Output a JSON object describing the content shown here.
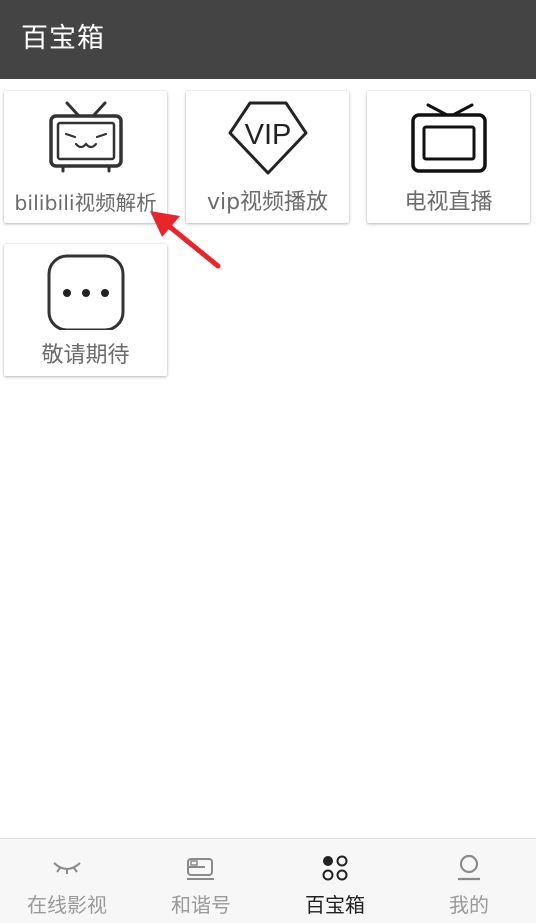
{
  "header": {
    "title": "百宝箱"
  },
  "grid": {
    "items": [
      {
        "label": "bilibili视频解析",
        "icon": "bilibili-tv-icon"
      },
      {
        "label": "vip视频播放",
        "icon": "vip-diamond-icon",
        "icon_text": "VIP"
      },
      {
        "label": "电视直播",
        "icon": "tv-icon"
      },
      {
        "label": "敬请期待",
        "icon": "more-dots-icon"
      }
    ]
  },
  "annotation": {
    "icon": "red-arrow-pointer",
    "color": "#e8262a"
  },
  "tabbar": {
    "tabs": [
      {
        "label": "在线影视",
        "icon": "eye-closed-icon",
        "active": false
      },
      {
        "label": "和谐号",
        "icon": "train-icon",
        "active": false
      },
      {
        "label": "百宝箱",
        "icon": "dots-grid-icon",
        "active": true
      },
      {
        "label": "我的",
        "icon": "person-icon",
        "active": false
      }
    ]
  },
  "colors": {
    "appbar": "#444444",
    "label_text": "#6b6b6b",
    "tab_inactive": "#9a9a9a",
    "tab_active": "#222222"
  }
}
